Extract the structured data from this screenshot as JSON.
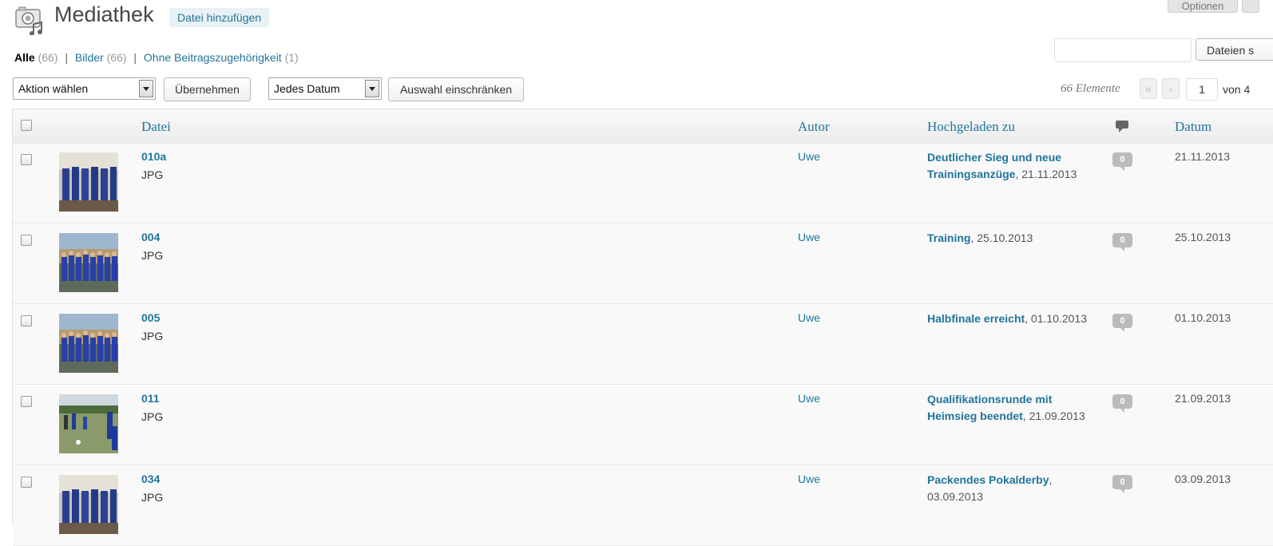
{
  "header": {
    "title": "Mediathek",
    "add_new": "Datei hinzufügen",
    "screen_options": "Optionen"
  },
  "filters": {
    "all": {
      "label": "Alle",
      "count": "(66)"
    },
    "images": {
      "label": "Bilder",
      "count": "(66)"
    },
    "unattached": {
      "label": "Ohne Beitragszugehörigkeit",
      "count": "(1)"
    },
    "separator": "|"
  },
  "search": {
    "button": "Dateien s"
  },
  "toolbar": {
    "bulk_action": "Aktion wählen",
    "apply": "Übernehmen",
    "date_filter": "Jedes Datum",
    "filter_button": "Auswahl einschränken"
  },
  "pagination": {
    "items": "66 Elemente",
    "first": "«",
    "prev": "‹",
    "current": "1",
    "total": "von 4"
  },
  "columns": {
    "file": "Datei",
    "author": "Autor",
    "uploaded_to": "Hochgeladen zu",
    "date": "Datum"
  },
  "rows": [
    {
      "title": "010a",
      "type": "JPG",
      "author": "Uwe",
      "post": "Deutlicher Sieg und neue Trainingsanzüge",
      "post_date": ", 21.11.2013",
      "comments": "0",
      "date": "21.11.2013",
      "thumb": "locker"
    },
    {
      "title": "004",
      "type": "JPG",
      "author": "Uwe",
      "post": "Training",
      "post_date": ", 25.10.2013",
      "comments": "0",
      "date": "25.10.2013",
      "thumb": "team"
    },
    {
      "title": "005",
      "type": "JPG",
      "author": "Uwe",
      "post": "Halbfinale erreicht",
      "post_date": ", 01.10.2013",
      "comments": "0",
      "date": "01.10.2013",
      "thumb": "team"
    },
    {
      "title": "011",
      "type": "JPG",
      "author": "Uwe",
      "post": "Qualifikationsrunde mit Heimsieg beendet",
      "post_date": ", 21.09.2013",
      "comments": "0",
      "date": "21.09.2013",
      "thumb": "field"
    },
    {
      "title": "034",
      "type": "JPG",
      "author": "Uwe",
      "post": "Packendes Pokalderby",
      "post_date": ", 03.09.2013",
      "comments": "0",
      "date": "03.09.2013",
      "thumb": "locker"
    }
  ]
}
